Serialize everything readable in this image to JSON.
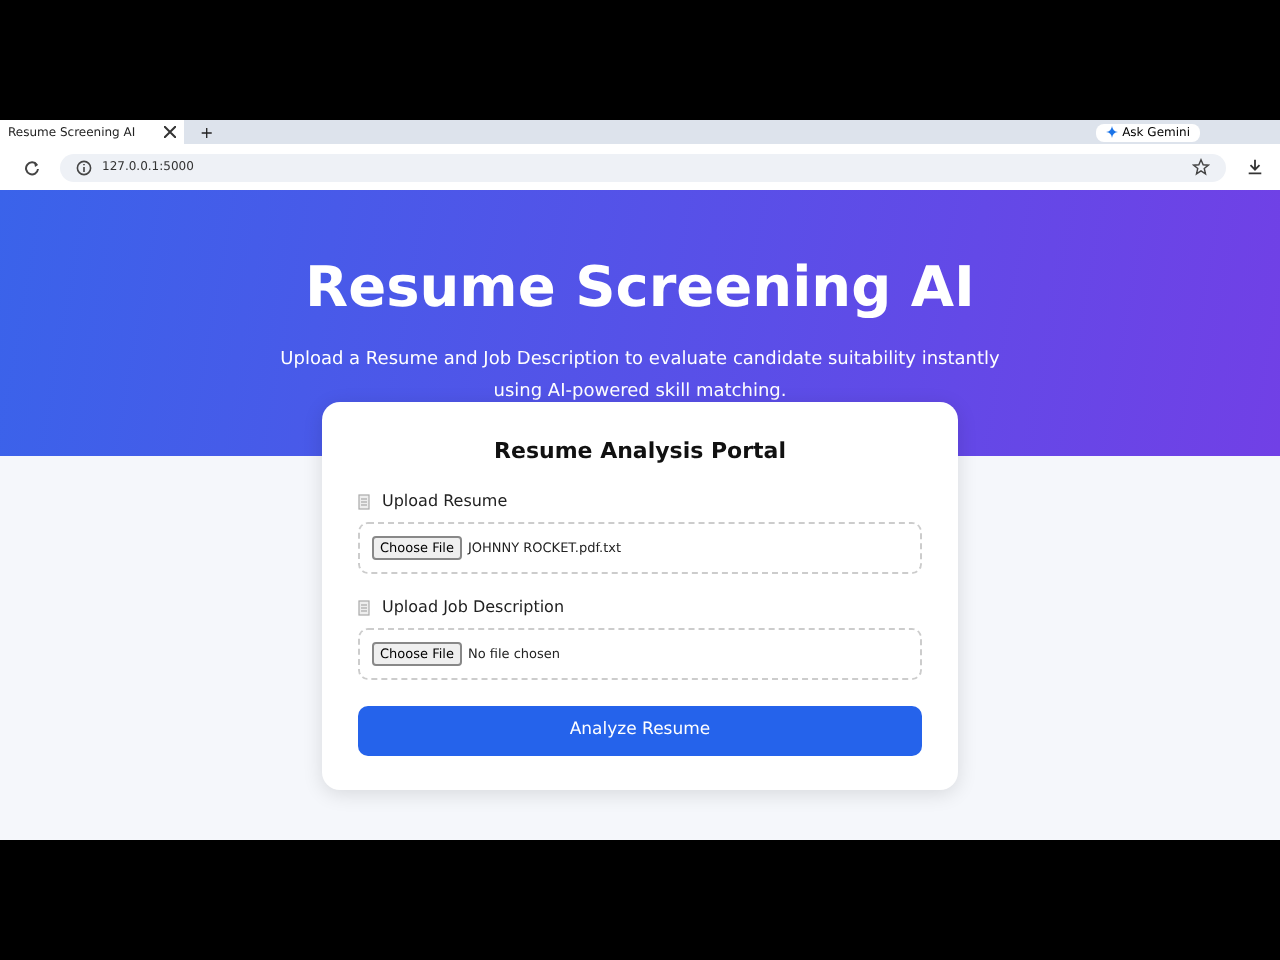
{
  "browser": {
    "tab_title": "Resume Screening AI",
    "new_tab": "+",
    "ask_button": "Ask Gemini",
    "url": "127.0.0.1:5000"
  },
  "hero": {
    "title": "Resume Screening AI",
    "subtitle": "Upload a Resume and Job Description to evaluate candidate suitability instantly using AI-powered skill matching."
  },
  "card": {
    "title": "Resume Analysis Portal",
    "fields": [
      {
        "label": "Upload Resume",
        "button": "Choose File",
        "file": "JOHNNY ROCKET.pdf.txt"
      },
      {
        "label": "Upload Job Description",
        "button": "Choose File",
        "file": "No file chosen"
      }
    ],
    "submit": "Analyze Resume"
  }
}
